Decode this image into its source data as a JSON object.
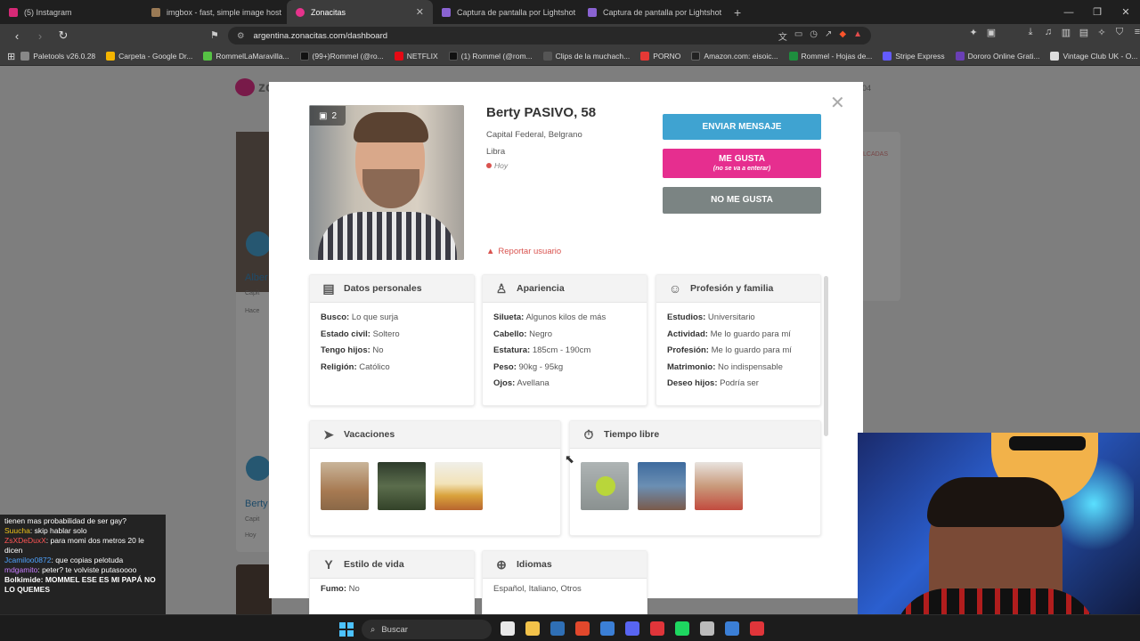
{
  "browser": {
    "tabs": [
      {
        "title": "(5) Instagram",
        "color": "#d62976",
        "active": false
      },
      {
        "title": "imgbox - fast, simple image host",
        "color": "#9a7a55",
        "active": false
      },
      {
        "title": "Zonacitas",
        "color": "#e6338c",
        "active": true
      },
      {
        "title": "Captura de pantalla por Lightshot",
        "color": "#8a63d2",
        "active": false
      },
      {
        "title": "Captura de pantalla por Lightshot",
        "color": "#8a63d2",
        "active": false
      }
    ],
    "url": "argentina.zonacitas.com/dashboard",
    "bookmarks": [
      {
        "label": "Paletools v26.0.28",
        "color": "#888"
      },
      {
        "label": "Carpeta - Google Dr...",
        "color": "#f4b400"
      },
      {
        "label": "RommelLaMaravilla...",
        "color": "#56c244"
      },
      {
        "label": "(99+)Rommel (@ro...",
        "color": "#111"
      },
      {
        "label": "NETFLIX",
        "color": "#e50914"
      },
      {
        "label": "(1) Rommel (@rom...",
        "color": "#111"
      },
      {
        "label": "Clips de la muchach...",
        "color": "#555"
      },
      {
        "label": "PORNO",
        "color": "#e53935"
      },
      {
        "label": "Amazon.com: eisoic...",
        "color": "#222"
      },
      {
        "label": "Rommel - Hojas de...",
        "color": "#1e8e3e"
      },
      {
        "label": "Stripe Express",
        "color": "#635bff"
      },
      {
        "label": "Dororo Online Grati...",
        "color": "#6a3fb5"
      },
      {
        "label": "Vintage Club UK - O...",
        "color": "#ddd"
      }
    ]
  },
  "profile": {
    "name": "Berty PASIVO, 58",
    "location": "Capital Federal, Belgrano",
    "sign": "Libra",
    "last_online": "Hoy",
    "photo_count": "2",
    "report_label": "Reportar usuario",
    "buttons": {
      "send": "ENVIAR MENSAJE",
      "like": "ME GUSTA",
      "like_sub": "(no se va a enterar)",
      "nolike": "NO ME GUSTA"
    }
  },
  "sections": {
    "personal": {
      "title": "Datos personales",
      "rows": [
        {
          "label": "Busco:",
          "value": "Lo que surja"
        },
        {
          "label": "Estado civil:",
          "value": "Soltero"
        },
        {
          "label": "Tengo hijos:",
          "value": "No"
        },
        {
          "label": "Religión:",
          "value": "Católico"
        }
      ]
    },
    "appearance": {
      "title": "Apariencia",
      "rows": [
        {
          "label": "Silueta:",
          "value": "Algunos kilos de más"
        },
        {
          "label": "Cabello:",
          "value": "Negro"
        },
        {
          "label": "Estatura:",
          "value": "185cm - 190cm"
        },
        {
          "label": "Peso:",
          "value": "90kg - 95kg"
        },
        {
          "label": "Ojos:",
          "value": "Avellana"
        }
      ]
    },
    "profession": {
      "title": "Profesión y familia",
      "rows": [
        {
          "label": "Estudios:",
          "value": "Universitario"
        },
        {
          "label": "Actividad:",
          "value": "Me lo guardo para mí"
        },
        {
          "label": "Profesión:",
          "value": "Me lo guardo para mí"
        },
        {
          "label": "Matrimonio:",
          "value": "No indispensable"
        },
        {
          "label": "Deseo hijos:",
          "value": "Podría ser"
        }
      ]
    },
    "vacations": {
      "title": "Vacaciones"
    },
    "freetime": {
      "title": "Tiempo libre"
    },
    "lifestyle": {
      "title": "Estilo de vida",
      "rows": [
        {
          "label": "Fumo:",
          "value": "No"
        }
      ]
    },
    "languages": {
      "title": "Idiomas",
      "text": "Español, Italiano, Otros"
    }
  },
  "background": {
    "name1": "Alber",
    "name2": "Berty",
    "sub1": "Capit",
    "sub2": "Capit",
    "time1": "Hace",
    "time2": "Hoy",
    "logo": "zo",
    "id_fragment": "04",
    "badge_fragment": "LCADAS"
  },
  "chat": [
    {
      "user": "",
      "text": "tienen mas probabilidad de ser gay?"
    },
    {
      "user": "Suucha",
      "text": "skip hablar solo"
    },
    {
      "user": "ZsXDeDuxX",
      "text": "para momi dos metros 20 le dicen"
    },
    {
      "user": "Jcamiloo0872",
      "text": "que copias pelotuda"
    },
    {
      "user": "mdgamito",
      "text": "peter? te volviste putasoooo"
    },
    {
      "user": "Bolkimide",
      "text": "MOMMEL ESE ES MI PAPÁ NO LO QUEMES"
    }
  ],
  "taskbar": {
    "search_placeholder": "Buscar",
    "icons": [
      "#e8e8e8",
      "#f2c24a",
      "#2f6fb5",
      "#e2482c",
      "#3b7fd6",
      "#5865f2",
      "#e0353a",
      "#1ed760",
      "#ffffff",
      "#3b7fd6",
      "#e0353a"
    ]
  }
}
